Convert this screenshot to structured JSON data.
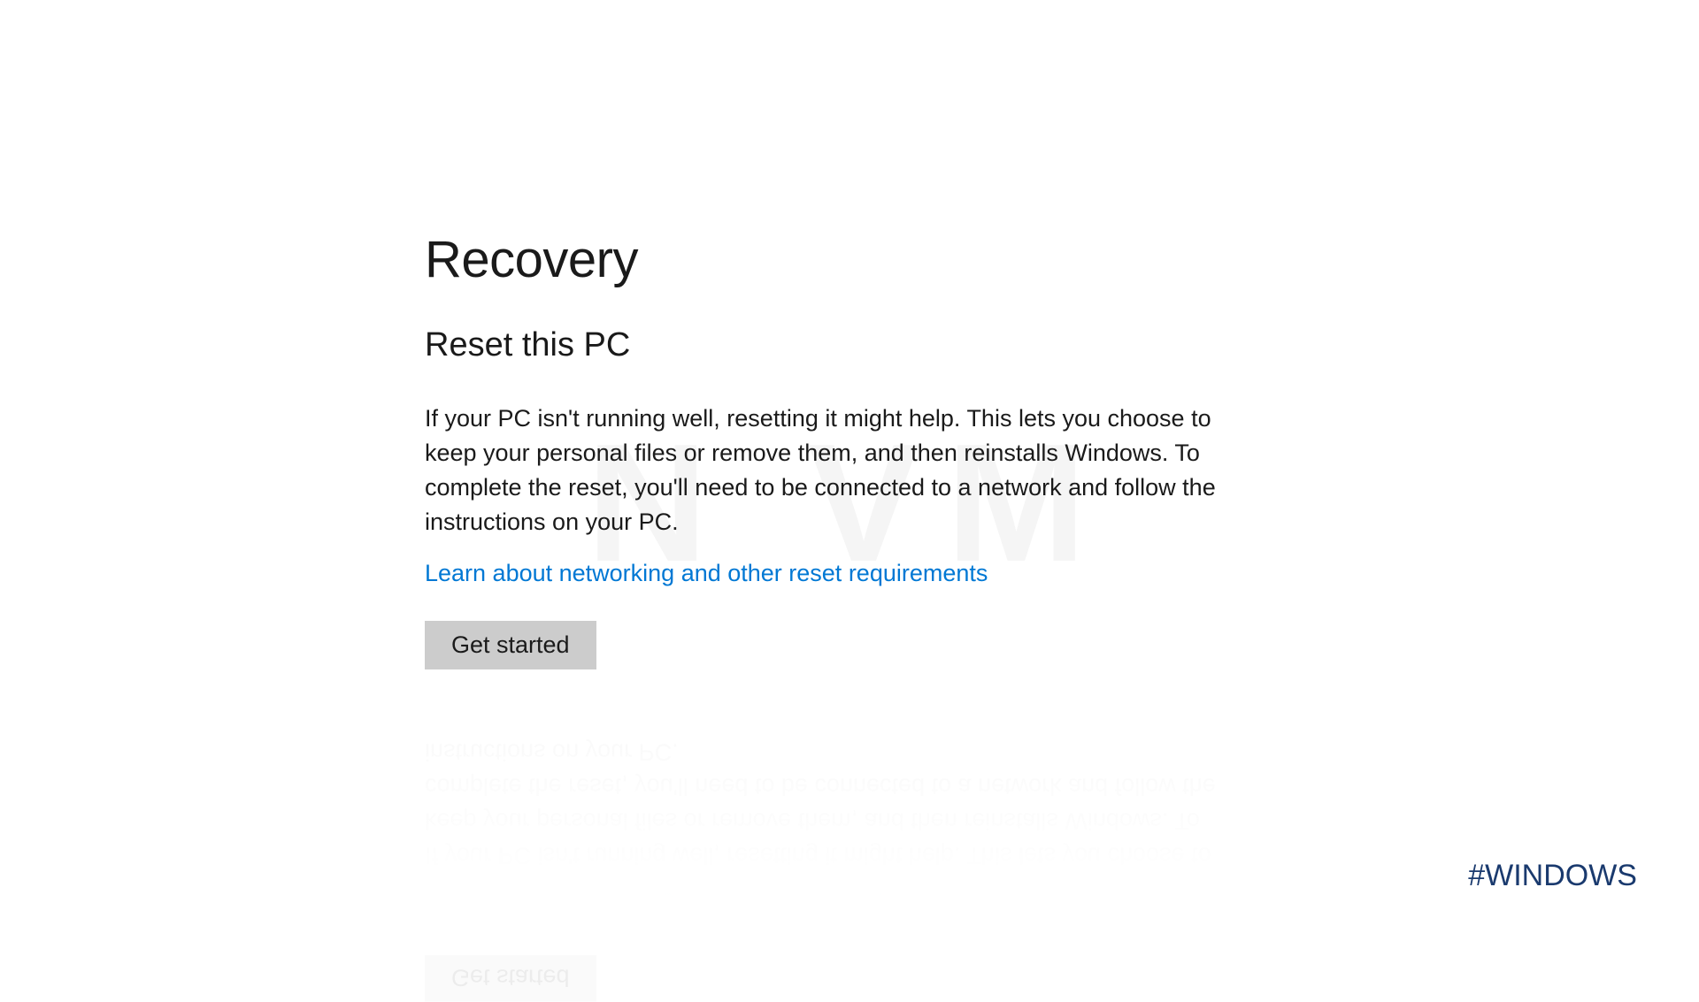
{
  "page": {
    "title": "Recovery"
  },
  "reset": {
    "section_title": "Reset this PC",
    "description": "If your PC isn't running well, resetting it might help. This lets you choose to keep your personal files or remove them, and then reinstalls Windows. To complete the reset, you'll need to be connected to a network and follow the instructions on your PC.",
    "learn_link": "Learn about networking and other reset requirements",
    "button_label": "Get started"
  },
  "hashtag": "#WINDOWS",
  "watermark": "N        VM"
}
